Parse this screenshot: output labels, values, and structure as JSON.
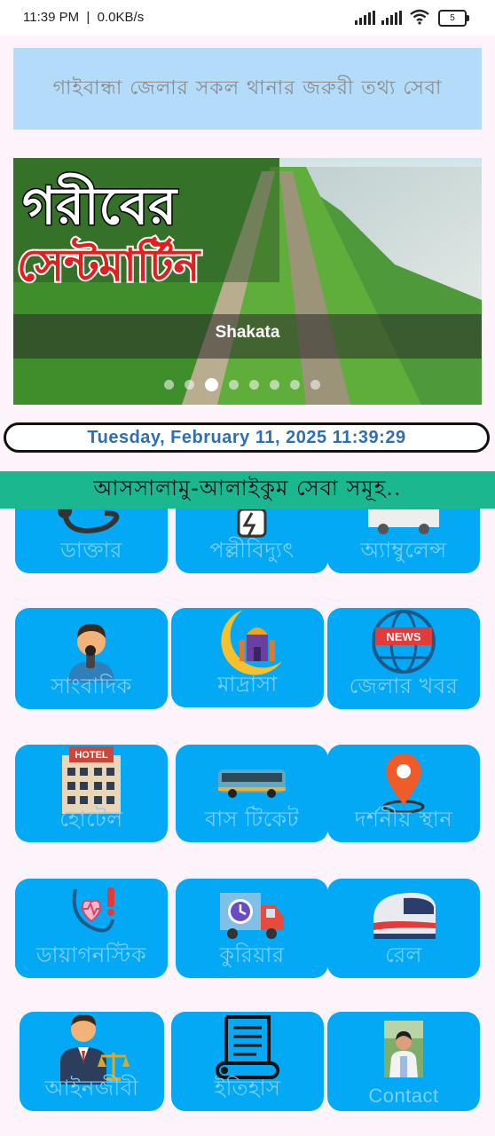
{
  "status_bar": {
    "time": "11:39 PM",
    "net_speed": "0.0KB/s",
    "battery": "5"
  },
  "header": {
    "title": "গাইবান্ধা জেলার সকল থানার জরুরী তথ্য সেবা"
  },
  "slider": {
    "poster_text_top": "গরীবের",
    "poster_text_bottom": "সেন্টমার্টিন",
    "caption": "Shakata",
    "dot_count": 8,
    "active_dot": 2
  },
  "datetime": "Tuesday, February 11, 2025 11:39:29",
  "banner": "আসসালামু-আলাইকুম সেবা সমূহ..",
  "services": [
    {
      "label": "ডাক্তার",
      "icon": "stethoscope-icon"
    },
    {
      "label": "পল্লীবিদ্যুৎ",
      "icon": "electricity-icon"
    },
    {
      "label": "অ্যাম্বুলেন্স",
      "icon": "ambulance-icon"
    },
    {
      "label": "সাংবাদিক",
      "icon": "reporter-icon"
    },
    {
      "label": "মাদ্রাসা",
      "icon": "mosque-moon-icon"
    },
    {
      "label": "জেলার খবর",
      "icon": "news-globe-icon"
    },
    {
      "label": "হোটেল",
      "icon": "hotel-icon"
    },
    {
      "label": "বাস টিকেট",
      "icon": "bus-icon"
    },
    {
      "label": "দর্শনীয় স্থান",
      "icon": "location-pin-icon"
    },
    {
      "label": "ডায়াগনস্টিক",
      "icon": "diagnostic-icon"
    },
    {
      "label": "কুরিয়ার",
      "icon": "courier-truck-icon"
    },
    {
      "label": "রেল",
      "icon": "train-icon"
    },
    {
      "label": "আইনজীবী",
      "icon": "lawyer-icon"
    },
    {
      "label": "ইতিহাস",
      "icon": "history-scroll-icon"
    },
    {
      "label": "Contact",
      "icon": "contact-photo-icon"
    }
  ]
}
